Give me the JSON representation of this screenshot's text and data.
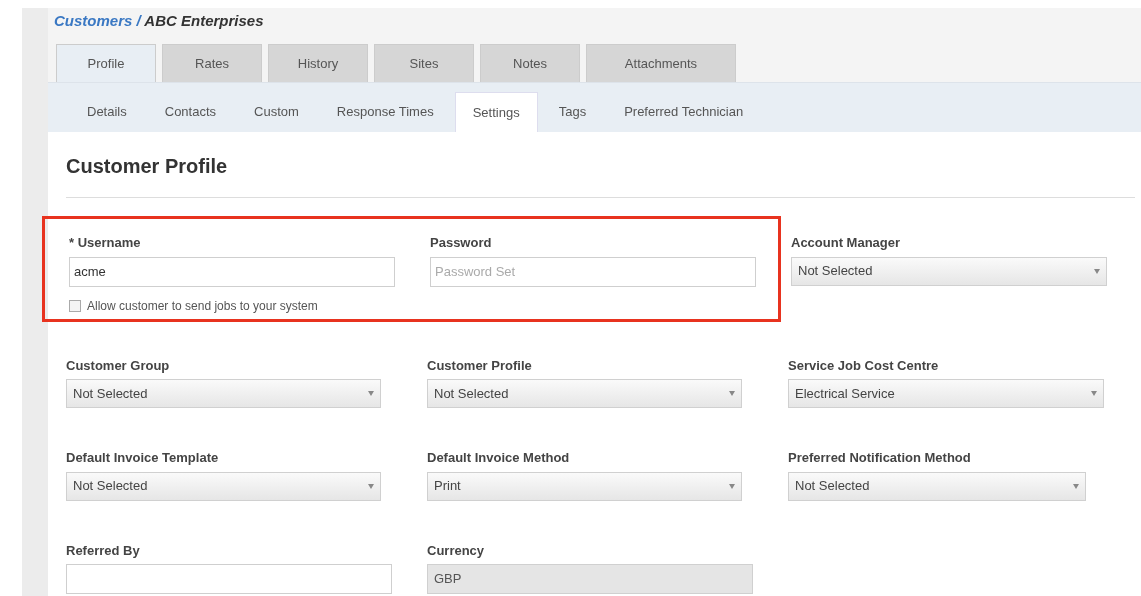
{
  "breadcrumb": {
    "parent": "Customers",
    "separator": "/",
    "current": "ABC Enterprises"
  },
  "tabs": [
    {
      "label": "Profile",
      "selected": true
    },
    {
      "label": "Rates",
      "selected": false
    },
    {
      "label": "History",
      "selected": false
    },
    {
      "label": "Sites",
      "selected": false
    },
    {
      "label": "Notes",
      "selected": false
    },
    {
      "label": "Attachments",
      "selected": false
    }
  ],
  "subtabs": [
    {
      "label": "Details",
      "selected": false
    },
    {
      "label": "Contacts",
      "selected": false
    },
    {
      "label": "Custom",
      "selected": false
    },
    {
      "label": "Response Times",
      "selected": false
    },
    {
      "label": "Settings",
      "selected": true
    },
    {
      "label": "Tags",
      "selected": false
    },
    {
      "label": "Preferred Technician",
      "selected": false
    }
  ],
  "heading": "Customer Profile",
  "login": {
    "highlighted": true,
    "fields": [
      {
        "kind": "text",
        "label": "* Username",
        "value": "acme"
      },
      {
        "kind": "text",
        "label": "Password",
        "placeholder": "Password Set"
      }
    ],
    "checkbox": {
      "label": "Allow customer to send jobs to your system",
      "checked": false
    }
  },
  "account_manager": {
    "kind": "select",
    "label": "Account Manager",
    "value": "Not Selected"
  },
  "fields": [
    {
      "kind": "select",
      "label": "Customer Group",
      "value": "Not Selected"
    },
    {
      "kind": "select",
      "label": "Customer Profile",
      "value": "Not Selected"
    },
    {
      "kind": "select",
      "label": "Service Job Cost Centre",
      "value": "Electrical Service"
    },
    {
      "kind": "select",
      "label": "Default Invoice Template",
      "value": "Not Selected"
    },
    {
      "kind": "select",
      "label": "Default Invoice Method",
      "value": "Print"
    },
    {
      "kind": "select",
      "label": "Preferred Notification Method",
      "value": "Not Selected"
    },
    {
      "kind": "text",
      "label": "Referred By"
    },
    {
      "kind": "readonly",
      "label": "Currency",
      "value": "GBP"
    }
  ]
}
